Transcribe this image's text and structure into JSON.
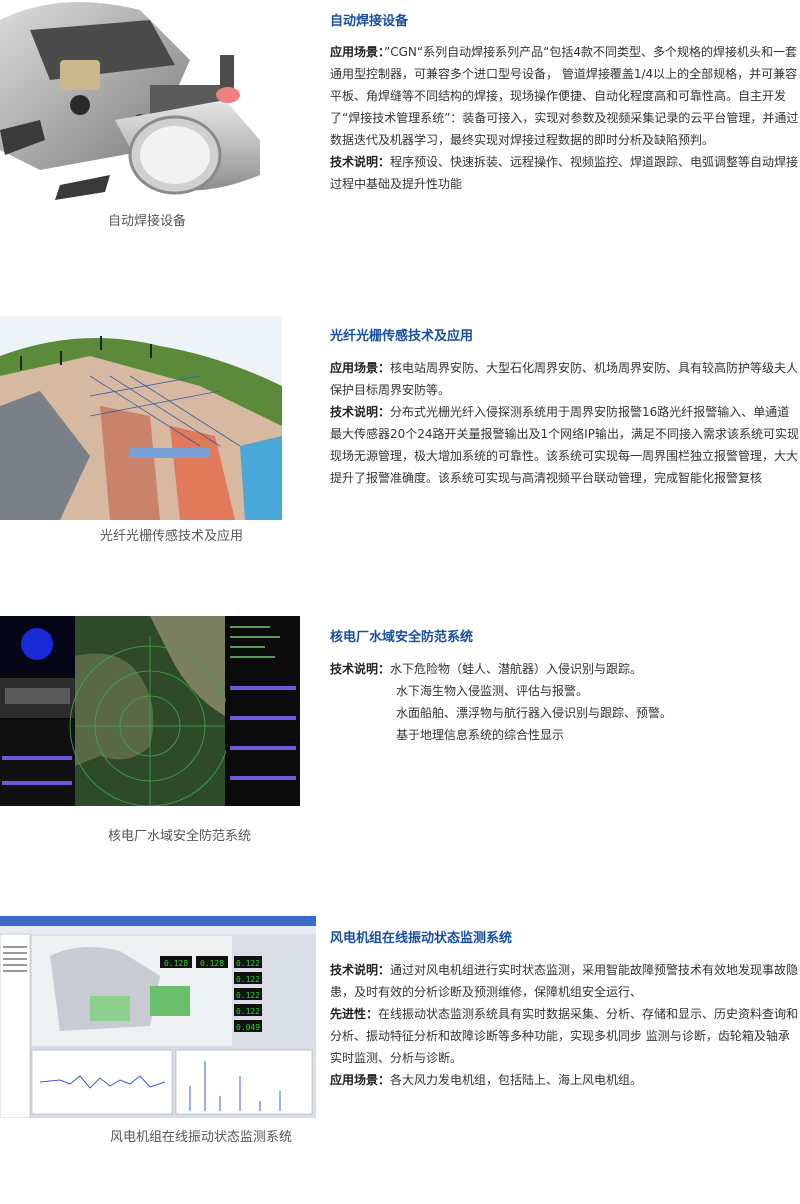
{
  "sections": [
    {
      "title": "自动焊接设备",
      "caption": "自动焊接设备",
      "p1_label": "应用场景：",
      "p1_text": "”CGN“系列自动焊接系列产品“包括4款不同类型、多个规格的焊接机头和一套通用型控制器，可兼容多个进口型号设备，  管道焊接覆盖1/4以上的全部规格，并可兼容平板、角焊缝等不同结构的焊接，现场操作便捷、自动化程度高和可靠性高。自主开发了“焊接技术管理系统”：装备可接入，实现对参数及视频采集记录的云平台管理，并通过数据迭代及机器学习，最终实现对焊接过程数据的即时分析及缺陷预判。",
      "p2_label": "技术说明：",
      "p2_text": "程序预设、快速拆装、远程操作、视频监控、焊道跟踪、电弧调整等自动焊接过程中基础及提升性功能"
    },
    {
      "title": "光纤光栅传感技术及应用",
      "caption": "光纤光栅传感技术及应用",
      "p1_label": "应用场景：",
      "p1_text": "核电站周界安防、大型石化周界安防、机场周界安防、具有较高防护等级夫人保护目标周界安防等。",
      "p2_label": "技术说明：",
      "p2_text": "分布式光栅光纤入侵探测系统用于周界安防报警16路光纤报警输入、单通道最大传感器20个24路开关量报警输出及1个网络IP输出，满足不同接入需求该系统可实现现场无源管理，极大增加系统的可靠性。该系统可实现每一周界围栏独立报警管理，大大提升了报警准确度。该系统可实现与高清视频平台联动管理，完成智能化报警复核"
    },
    {
      "title": "核电厂水域安全防范系统",
      "caption": "核电厂水域安全防范系统",
      "label": "技术说明：",
      "lines": [
        "水下危险物（蛙人、潜航器）入侵识别与跟踪。",
        "水下海生物入侵监测、评估与报警。",
        "水面船舶、漂浮物与航行器入侵识别与跟踪、预警。",
        "基于地理信息系统的综合性显示"
      ]
    },
    {
      "title": "风电机组在线振动状态监测系统",
      "caption": "风电机组在线振动状态监测系统",
      "p1_label": "技术说明：",
      "p1_text": "通过对风电机组进行实时状态监测，采用智能故障预警技术有效地发现事故隐患，及时有效的分析诊断及预测维修，保障机组安全运行、",
      "p2_label": "先进性：",
      "p2_text": "在线振动状态监测系统具有实时数据采集、分析、存储和显示、历史资料查询和分析、振动特征分析和故障诊断等多种功能，实现多机同步 监测与诊断，齿轮箱及轴承实时监测、分析与诊断。",
      "p3_label": "应用场景：",
      "p3_text": "各大风力发电机组，包括陆上、海上风电机组。"
    }
  ],
  "panel_readings": [
    "0.128",
    "0.128",
    "0.122",
    "0.122",
    "0.122",
    "0.122",
    "0.049"
  ],
  "colors": {
    "title": "#1a4fa0",
    "text": "#333333",
    "sea": "#4aa8d8",
    "monitor_bg": "#0a0a0a",
    "readout_green": "#2ad62a"
  }
}
